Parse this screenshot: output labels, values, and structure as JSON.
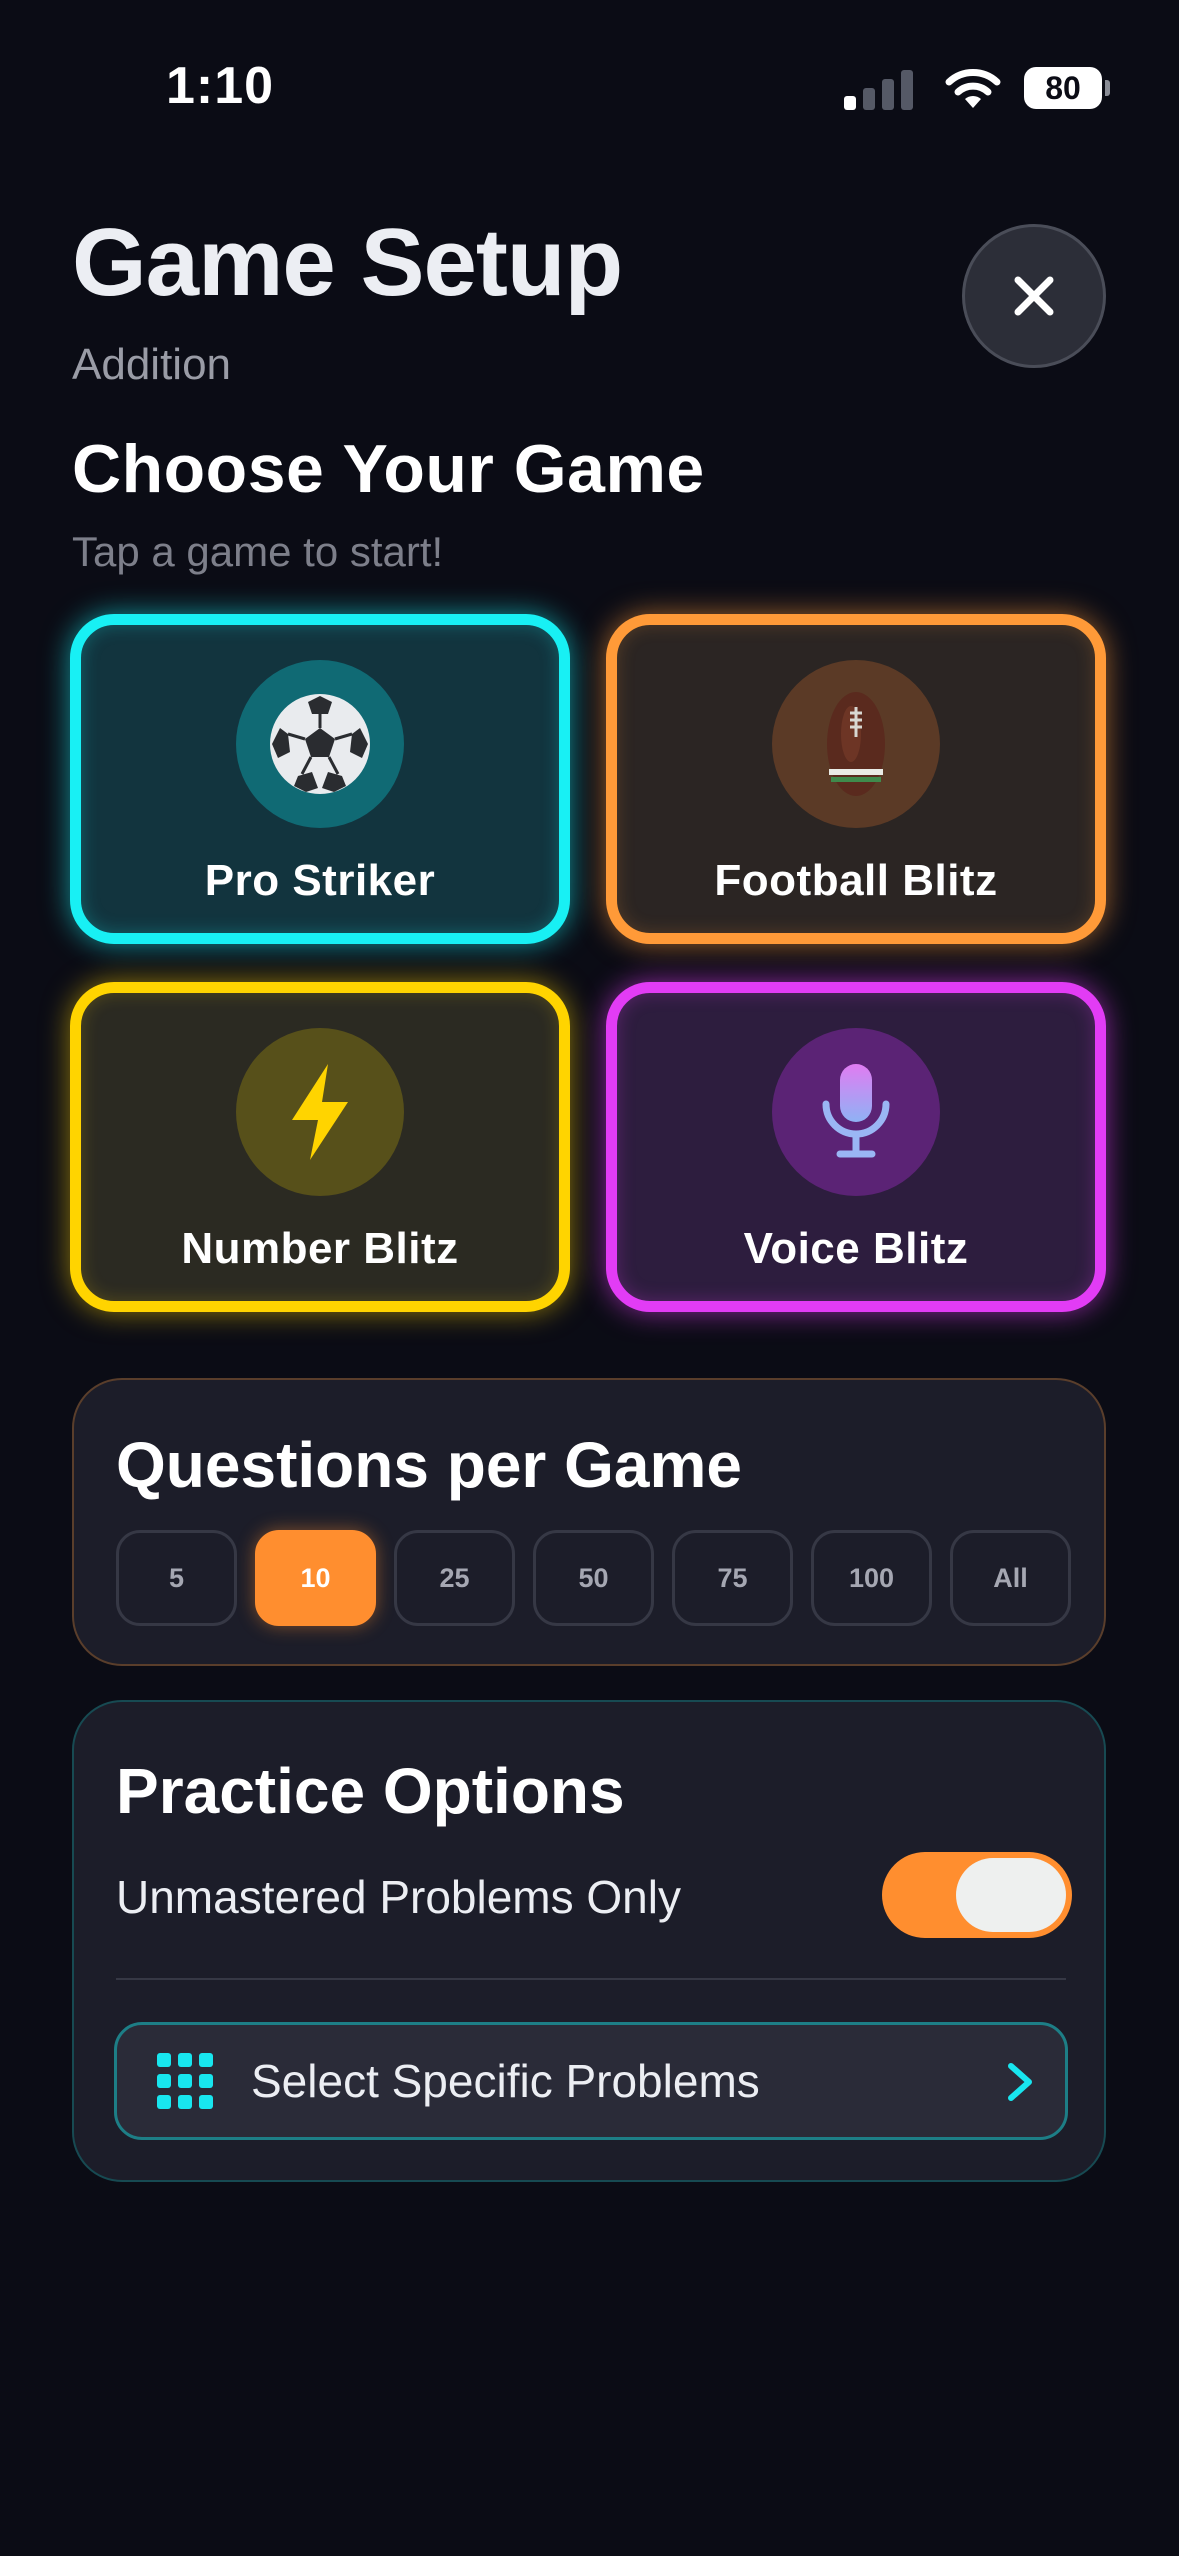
{
  "status_bar": {
    "time": "1:10",
    "battery": "80"
  },
  "header": {
    "title": "Game Setup",
    "subtitle": "Addition"
  },
  "games_section": {
    "title": "Choose Your Game",
    "hint": "Tap a game to start!",
    "games": [
      {
        "label": "Pro Striker",
        "icon": "soccer-ball-icon",
        "accent": "#18f0f4"
      },
      {
        "label": "Football Blitz",
        "icon": "american-football-icon",
        "accent": "#ff9a38"
      },
      {
        "label": "Number Blitz",
        "icon": "lightning-bolt-icon",
        "accent": "#ffd400"
      },
      {
        "label": "Voice Blitz",
        "icon": "microphone-icon",
        "accent": "#e23cf5"
      }
    ]
  },
  "questions": {
    "title": "Questions per Game",
    "options": [
      "5",
      "10",
      "25",
      "50",
      "75",
      "100",
      "All"
    ],
    "selected": "10",
    "accent": "#ff8e2f"
  },
  "practice": {
    "title": "Practice Options",
    "unmastered_label": "Unmastered Problems Only",
    "unmastered_on": true,
    "select_label": "Select Specific Problems",
    "accent": "#18e6ef"
  }
}
